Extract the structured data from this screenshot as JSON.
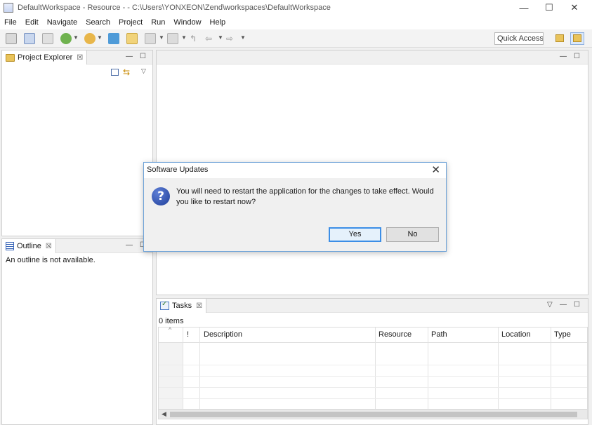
{
  "window": {
    "title": "DefaultWorkspace - Resource - - C:\\Users\\YONXEON\\Zend\\workspaces\\DefaultWorkspace",
    "minimize": "—",
    "maximize": "☐",
    "close": "✕"
  },
  "menu": [
    "File",
    "Edit",
    "Navigate",
    "Search",
    "Project",
    "Run",
    "Window",
    "Help"
  ],
  "toolbar": {
    "quick_access_label": "Quick Access"
  },
  "project_explorer": {
    "tab_label": "Project Explorer",
    "close": "☒",
    "minimize": "—",
    "maximize": "☐",
    "view_menu": "▽"
  },
  "outline": {
    "tab_label": "Outline",
    "close": "☒",
    "minimize": "—",
    "maximize": "☐",
    "message": "An outline is not available."
  },
  "editor": {
    "minimize": "—",
    "maximize": "☐"
  },
  "tasks": {
    "tab_label": "Tasks",
    "close": "☒",
    "view_menu": "▽",
    "minimize": "—",
    "maximize": "☐",
    "count": "0 items",
    "sort_indicator": "^",
    "columns": [
      "!",
      "Description",
      "Resource",
      "Path",
      "Location",
      "Type"
    ]
  },
  "dialog": {
    "title": "Software Updates",
    "close": "✕",
    "icon_glyph": "?",
    "message": "You will need to restart the application for the changes to take effect. Would you like to restart now?",
    "yes_label": "Yes",
    "no_label": "No"
  }
}
